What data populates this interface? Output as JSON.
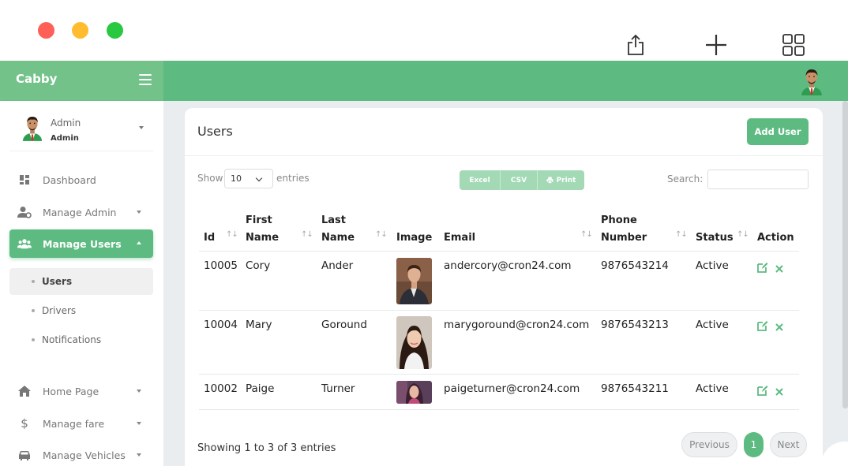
{
  "app": {
    "brand": "Cabby"
  },
  "profile": {
    "name": "Admin",
    "role": "Admin"
  },
  "sidebar": {
    "items": [
      {
        "label": "Dashboard",
        "icon": "dashboard-icon"
      },
      {
        "label": "Manage Admin",
        "icon": "admin-icon"
      },
      {
        "label": "Manage Users",
        "icon": "users-icon"
      },
      {
        "label": "Home Page",
        "icon": "home-icon"
      },
      {
        "label": "Manage fare",
        "icon": "dollar-icon"
      },
      {
        "label": "Manage Vehicles",
        "icon": "car-icon"
      }
    ],
    "sub_items": [
      {
        "label": "Users"
      },
      {
        "label": "Drivers"
      },
      {
        "label": "Notifications"
      }
    ]
  },
  "page": {
    "title": "Users",
    "add_button": "Add User"
  },
  "controls": {
    "show_label": "Show",
    "page_size": "10",
    "entries_label": "entries",
    "export_excel": "Excel",
    "export_csv": "CSV",
    "export_print": "Print",
    "search_label": "Search:",
    "search_value": ""
  },
  "table": {
    "headers": {
      "id": "Id",
      "first_name_1": "First",
      "first_name_2": "Name",
      "last_name_1": "Last",
      "last_name_2": "Name",
      "image": "Image",
      "email": "Email",
      "phone_1": "Phone",
      "phone_2": "Number",
      "status": "Status",
      "action": "Action"
    },
    "rows": [
      {
        "id": "10005",
        "first": "Cory",
        "last": "Ander",
        "email": "andercory@cron24.com",
        "phone": "9876543214",
        "status": "Active"
      },
      {
        "id": "10004",
        "first": "Mary",
        "last": "Goround",
        "email": "marygoround@cron24.com",
        "phone": "9876543213",
        "status": "Active"
      },
      {
        "id": "10002",
        "first": "Paige",
        "last": "Turner",
        "email": "paigeturner@cron24.com",
        "phone": "9876543211",
        "status": "Active"
      }
    ]
  },
  "footer": {
    "info": "Showing 1 to 3 of 3 entries",
    "previous": "Previous",
    "current_page": "1",
    "next": "Next"
  },
  "colors": {
    "accent": "#5dbb81",
    "brand_bar": "#72c28a"
  }
}
